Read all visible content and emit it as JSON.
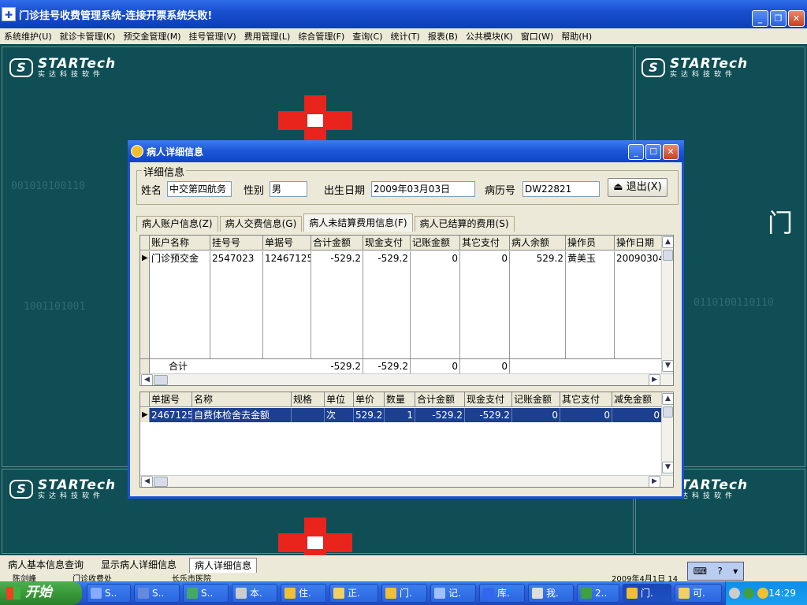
{
  "window": {
    "title": "门诊挂号收费管理系统-连接开票系统失败!",
    "app_icon": "hospital-app-icon"
  },
  "menu": [
    "系统维护(U)",
    "就诊卡管理(K)",
    "预交金管理(M)",
    "挂号管理(V)",
    "费用管理(L)",
    "综合管理(F)",
    "查询(C)",
    "统计(T)",
    "报表(B)",
    "公共模块(K)",
    "窗口(W)",
    "帮助(H)"
  ],
  "background": {
    "logo_brand": "STARTech",
    "logo_cn": "实达科技软件",
    "binary_1": "001010100110",
    "binary_2": "1001101001",
    "binary_3": "0110100110110",
    "right_text": "门"
  },
  "dialog": {
    "title": "病人详细信息",
    "group_label": "详细信息",
    "fields": {
      "name_label": "姓名",
      "name_value": "中交第四航务",
      "gender_label": "性别",
      "gender_value": "男",
      "birth_label": "出生日期",
      "birth_value": "2009年03月03日",
      "record_label": "病历号",
      "record_value": "DW22821"
    },
    "exit_button": "退出(X)",
    "tabs": [
      "病人账户信息(Z)",
      "病人交费信息(G)",
      "病人未结算费用信息(F)",
      "病人已结算的费用(S)"
    ],
    "active_tab": 2,
    "top_grid": {
      "columns": [
        "账户名称",
        "挂号号",
        "单据号",
        "合计金额",
        "现金支付",
        "记账金额",
        "其它支付",
        "病人余额",
        "操作员",
        "操作日期"
      ],
      "rows": [
        [
          "门诊预交金",
          "2547023",
          "12467125",
          "-529.2",
          "-529.2",
          "0",
          "0",
          "529.2",
          "黄美玉",
          "20090304"
        ]
      ],
      "total_row": {
        "label": "合计",
        "total": "-529.2",
        "cash": "-529.2",
        "account": "0",
        "other": "0"
      }
    },
    "bottom_grid": {
      "columns": [
        "单据号",
        "名称",
        "规格",
        "单位",
        "单价",
        "数量",
        "合计金额",
        "现金支付",
        "记账金额",
        "其它支付",
        "减免金额"
      ],
      "rows": [
        [
          "2467125",
          "自费体检舍去金额",
          "",
          "次",
          "529.2",
          "1",
          "-529.2",
          "-529.2",
          "0",
          "0",
          "0"
        ]
      ]
    }
  },
  "mdi_tabs": [
    "病人基本信息查询",
    "显示病人详细信息",
    "病人详细信息"
  ],
  "mdi_active": 2,
  "status": {
    "s1": "陈剑峰",
    "s2": "门诊收费处",
    "s3": "长乐市医院",
    "s4": "2009年4月1日 14"
  },
  "taskbar": {
    "start": "开始",
    "tasks": [
      "S..",
      "S..",
      "S..",
      "本.",
      "住.",
      "正.",
      "门.",
      "记.",
      "库.",
      "我.",
      "2..",
      "门.",
      "可."
    ],
    "active_task": 11,
    "clock": "14:29"
  },
  "colors": {
    "desktop_bg": "#0d4d52",
    "title_blue": "#1a4fd0",
    "selection": "#1c3f8f",
    "cross_red": "#e8241c"
  }
}
